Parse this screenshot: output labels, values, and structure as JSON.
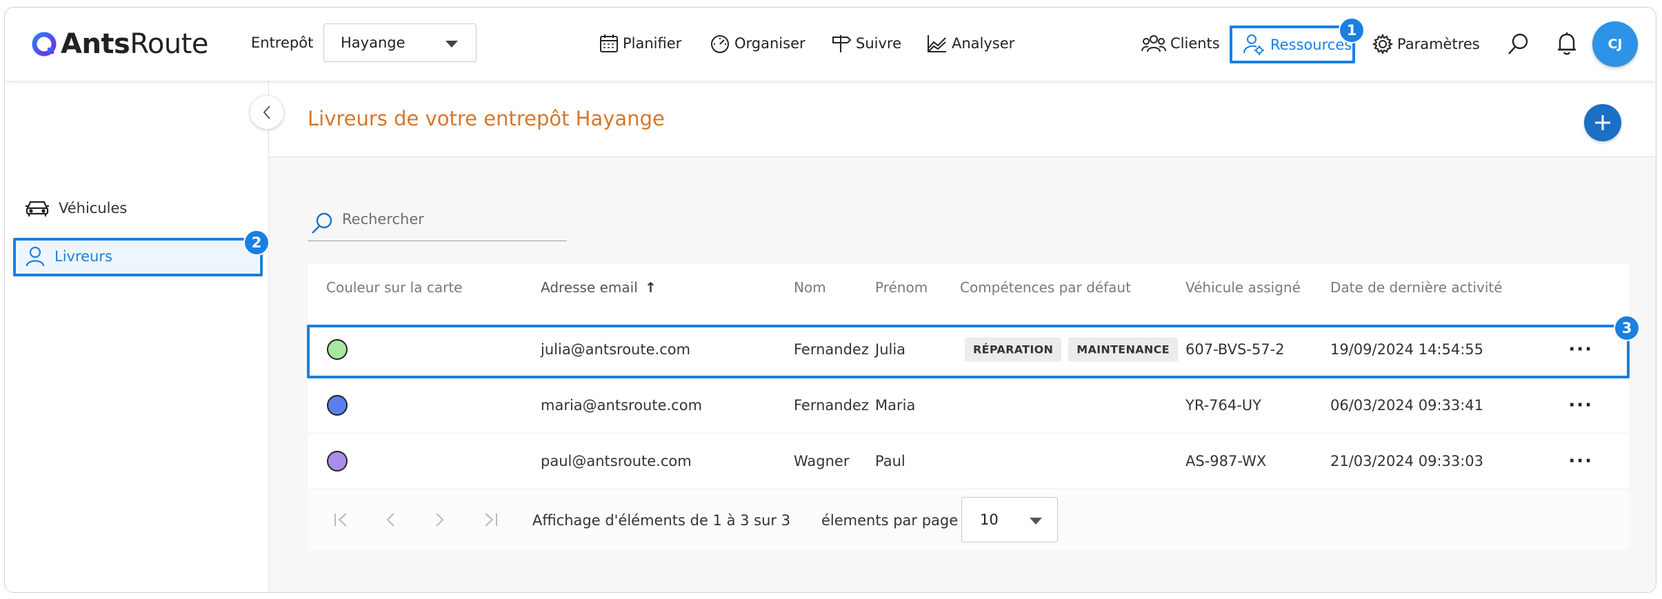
{
  "app": {
    "logo_bold": "Ants",
    "logo_light": "Route"
  },
  "header": {
    "warehouse_label": "Entrepôt",
    "warehouse_value": "Hayange",
    "nav": [
      {
        "label": "Planifier",
        "icon": "calendar-icon"
      },
      {
        "label": "Organiser",
        "icon": "gauge-icon"
      },
      {
        "label": "Suivre",
        "icon": "signpost-icon"
      },
      {
        "label": "Analyser",
        "icon": "chart-icon"
      },
      {
        "label": "Clients",
        "icon": "people-icon"
      },
      {
        "label": "Ressources",
        "icon": "user-gear-icon",
        "active": true
      },
      {
        "label": "Paramètres",
        "icon": "gear-icon"
      }
    ],
    "avatar_initials": "CJ"
  },
  "sidebar": {
    "items": [
      {
        "label": "Véhicules",
        "icon": "car-icon"
      },
      {
        "label": "Livreurs",
        "icon": "user-icon",
        "active": true
      }
    ]
  },
  "main": {
    "title": "Livreurs de votre entrepôt Hayange",
    "search_placeholder": "Rechercher"
  },
  "table": {
    "columns": [
      "Couleur sur la carte",
      "Adresse email",
      "Nom",
      "Prénom",
      "Compétences par défaut",
      "Véhicule assigné",
      "Date de dernière activité"
    ],
    "sort_indicator": "↑",
    "rows": [
      {
        "color": "#a8e6a1",
        "email": "julia@antsroute.com",
        "nom": "Fernandez",
        "prenom": "Julia",
        "skills": [
          "RÉPARATION",
          "MAINTENANCE"
        ],
        "vehicle": "607-BVS-57-2",
        "last_activity": "19/09/2024 14:54:55"
      },
      {
        "color": "#5b7ff0",
        "email": "maria@antsroute.com",
        "nom": "Fernandez",
        "prenom": "Maria",
        "skills": [],
        "vehicle": "YR-764-UY",
        "last_activity": "06/03/2024 09:33:41"
      },
      {
        "color": "#a98de8",
        "email": "paul@antsroute.com",
        "nom": "Wagner",
        "prenom": "Paul",
        "skills": [],
        "vehicle": "AS-987-WX",
        "last_activity": "21/03/2024 09:33:03"
      }
    ],
    "more_label": "···"
  },
  "pagination": {
    "summary": "Affichage d'éléments de 1 à 3 sur 3",
    "per_page_label": "élements par page",
    "per_page_value": "10"
  },
  "annotations": [
    "1",
    "2",
    "3"
  ],
  "colors": {
    "accent": "#1b7fe0",
    "title": "#d8762a",
    "add_button": "#1b6fc4"
  }
}
